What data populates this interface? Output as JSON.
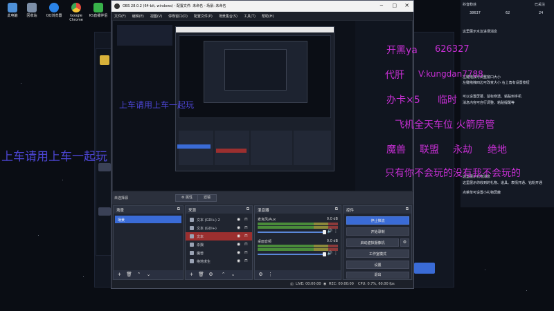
{
  "desktop": {
    "icons": [
      {
        "label": "此电脑",
        "color": "#4e90d8"
      },
      {
        "label": "回收站",
        "color": "#7d8fa8"
      },
      {
        "label": "QQ浏览器",
        "color": "#2a83e8"
      },
      {
        "label": "Google Chrome",
        "color": "#e24b3b"
      },
      {
        "label": "KS直播伴侣",
        "color": "#38b24a"
      }
    ]
  },
  "overlay": {
    "left_big_1": "上车请用上车一起玩",
    "left_big_2": "上车请用上车一起玩",
    "lines": [
      "开黑ya",
      "626327",
      "代肝",
      "V:kungdan7788",
      "办卡×5",
      "临时",
      "飞机全天车位 火箭房管",
      "魔兽",
      "联盟",
      "永劫",
      "绝地",
      "只有你不会玩的没有我不会玩的"
    ]
  },
  "right_panel": {
    "header": {
      "left": "抖音粉丝",
      "right": "已关注"
    },
    "stats": [
      "38637",
      "62",
      "24"
    ],
    "chat": [
      "这里展示水友进场消息",
      "左键拖拽可调整窗口大小",
      "左键拖拽四边可改变大小 右上角有设置按钮",
      "可以设置屏幕、鼠标穿透、粘贴到手机",
      "消息内容可自行调整、粘贴提醒等",
      "这里展示礼物消息",
      "这里展示你收到的礼物、道具、表情开通、钻粉开通",
      "点菜单可设置小礼物屏蔽"
    ]
  },
  "obs": {
    "title": "OBS 28.0.2 (64-bit, windows) - 配置文件: 未命名 - 场景: 未命名",
    "menu": [
      "文件(F)",
      "编辑(E)",
      "视图(V)",
      "停靠窗口(D)",
      "配置文件(P)",
      "场景集合(S)",
      "工具(T)",
      "帮助(H)"
    ],
    "no_source": "未选择源",
    "properties_btn": "属性",
    "filters_btn": "滤镜",
    "scenes": {
      "title": "场景",
      "items": [
        "场景"
      ]
    },
    "sources": {
      "title": "来源",
      "items": [
        {
          "label": "文本 (GDI+) 2",
          "selected": false
        },
        {
          "label": "文本 (GDI+)",
          "selected": false
        },
        {
          "label": "文本",
          "selected": true
        },
        {
          "label": "杀戮",
          "selected": false
        },
        {
          "label": "魔兽",
          "selected": false
        },
        {
          "label": "绝地求生",
          "selected": false
        }
      ]
    },
    "mixer": {
      "title": "混音器",
      "channels": [
        {
          "name": "麦克风/Aux",
          "db": "0.0 dB",
          "level": 0.72
        },
        {
          "name": "桌面音频",
          "db": "0.0 dB",
          "level": 0.72
        }
      ]
    },
    "controls": {
      "title": "控件",
      "buttons": [
        "停止推流",
        "开始录制",
        "启动虚拟摄像机",
        "工作室模式",
        "设置",
        "退出"
      ]
    },
    "status": {
      "live": "LIVE: 00:00:00",
      "rec": "REC: 00:00:00",
      "cpu": "CPU: 0.7%, 60.00 fps"
    }
  },
  "colors": {
    "overlay_magenta": "#c72fd4",
    "overlay_blue": "#4d46d6",
    "accent_blue": "#3a6bd6",
    "selected_red": "#9b2f2f"
  }
}
